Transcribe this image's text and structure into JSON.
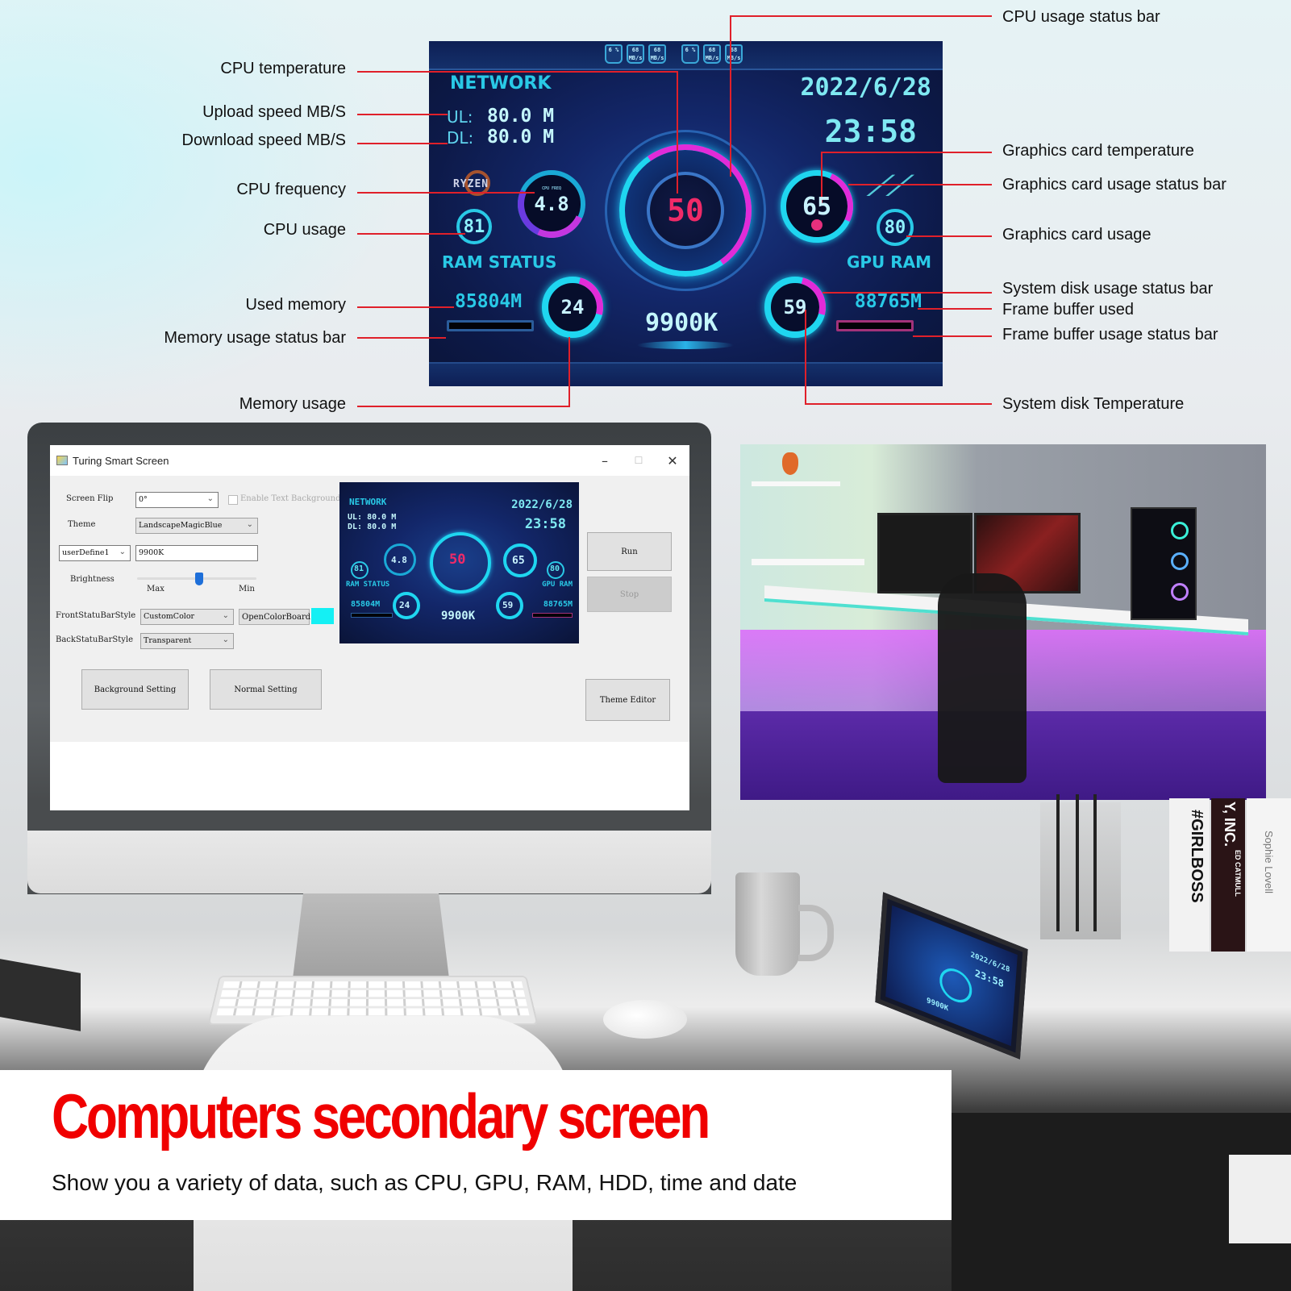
{
  "dashboard": {
    "network_title": "NETWORK",
    "ul_label": "UL:",
    "ul_value": "80.0 M",
    "dl_label": "DL:",
    "dl_value": "80.0 M",
    "date": "2022/6/28",
    "time": "23:58",
    "brand_logo": "RYZEN",
    "cpu_frequency": "4.8",
    "cpu_frequency_caption": "CPU FREQ",
    "cpu_usage": "81",
    "cpu_temperature": "50",
    "gpu_temperature": "65",
    "gpu_usage": "80",
    "ram_title": "RAM  STATUS",
    "gpu_ram_title": "GPU RAM",
    "used_memory": "85804M",
    "memory_usage": "24",
    "cpu_model": "9900K",
    "disk_temperature": "59",
    "frame_buffer_used": "88765M",
    "gpu_logo_icon": "rog-logo-icon",
    "top_icons": [
      "6 %",
      "68 MB/s",
      "68 MB/s",
      "6 %",
      "68 MB/s",
      "68 MB/s"
    ],
    "colors": {
      "accent_cyan": "#1fd6f0",
      "accent_magenta": "#e12bd8",
      "temp_red": "#f02a68",
      "background": "#13276a"
    },
    "status_bars": {
      "cpu_usage_fraction": 0.5,
      "gpu_usage_fraction": 0.8,
      "memory_usage_fraction": 0.24,
      "disk_usage_fraction": 0.59
    }
  },
  "callouts": {
    "left": [
      "CPU temperature",
      "Upload speed MB/S",
      "Download speed MB/S",
      "CPU frequency",
      "CPU usage",
      "Used memory",
      "Memory usage status bar",
      "Memory usage"
    ],
    "right": [
      "CPU usage status bar",
      "Graphics card temperature",
      "Graphics card usage status bar",
      "Graphics card usage",
      "System disk usage status bar",
      "Frame buffer used",
      "Frame buffer usage status bar",
      "System disk Temperature"
    ]
  },
  "app": {
    "title": "Turing Smart Screen",
    "window_controls": {
      "minimize": "–",
      "maximize": "☐",
      "close": "✕"
    },
    "screen_flip_label": "Screen Flip",
    "screen_flip_value": "0°",
    "enable_text_background_label": "Enable Text Background",
    "enable_text_background_checked": false,
    "theme_label": "Theme",
    "theme_value": "LandscapeMagicBlue",
    "user_define_value": "userDefine1",
    "user_define_text": "9900K",
    "brightness_label": "Brightness",
    "brightness_max_label": "Max",
    "brightness_min_label": "Min",
    "brightness_position_fraction": 0.52,
    "front_bar_style_label": "FrontStatuBarStyle",
    "front_bar_style_value": "CustomColor",
    "open_color_board_label": "OpenColorBoard",
    "selected_color": "#14f0f4",
    "back_bar_style_label": "BackStatuBarStyle",
    "back_bar_style_value": "Transparent",
    "background_setting_label": "Background Setting",
    "normal_setting_label": "Normal Setting",
    "run_label": "Run",
    "stop_label": "Stop",
    "theme_editor_label": "Theme Editor"
  },
  "photo_props": {
    "book_titles": [
      "#GIRLBOSS",
      "Y, INC.",
      "ED CATMULL",
      "Sophie Lovell"
    ]
  },
  "caption": {
    "title": "Computers secondary screen",
    "subtitle": "Show you a variety of data, such as CPU, GPU, RAM, HDD, time and date",
    "title_color": "#f00000"
  }
}
